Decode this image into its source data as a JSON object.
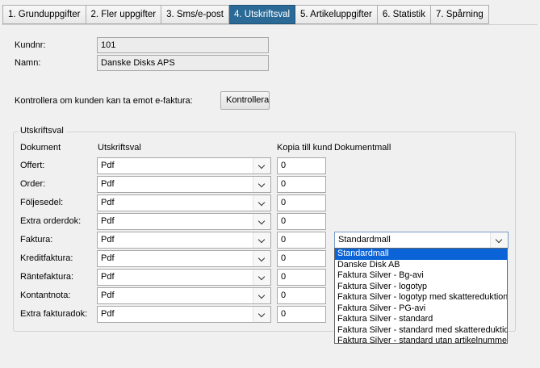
{
  "tabs": [
    {
      "label": "1. Grunduppgifter"
    },
    {
      "label": "2. Fler uppgifter"
    },
    {
      "label": "3. Sms/e-post"
    },
    {
      "label": "4. Utskriftsval"
    },
    {
      "label": "5. Artikeluppgifter"
    },
    {
      "label": "6. Statistik"
    },
    {
      "label": "7. Spårning"
    }
  ],
  "active_tab_index": 3,
  "customer": {
    "kundnr_label": "Kundnr:",
    "kundnr_value": "101",
    "namn_label": "Namn:",
    "namn_value": "Danske Disks APS"
  },
  "efaktura": {
    "label": "Kontrollera om kunden kan ta emot e-faktura:",
    "button": "Kontrollera"
  },
  "print_options": {
    "group_title": "Utskriftsval",
    "headers": {
      "dokument": "Dokument",
      "utskriftsval": "Utskriftsval",
      "kopia": "Kopia till kund",
      "mall": "Dokumentmall"
    },
    "rows": [
      {
        "label": "Offert:",
        "choice": "Pdf",
        "copies": "0"
      },
      {
        "label": "Order:",
        "choice": "Pdf",
        "copies": "0"
      },
      {
        "label": "Följesedel:",
        "choice": "Pdf",
        "copies": "0"
      },
      {
        "label": "Extra orderdok:",
        "choice": "Pdf",
        "copies": "0"
      },
      {
        "label": "Faktura:",
        "choice": "Pdf",
        "copies": "0"
      },
      {
        "label": "Kreditfaktura:",
        "choice": "Pdf",
        "copies": "0"
      },
      {
        "label": "Räntefaktura:",
        "choice": "Pdf",
        "copies": "0"
      },
      {
        "label": "Kontantnota:",
        "choice": "Pdf",
        "copies": "0"
      },
      {
        "label": "Extra fakturadok:",
        "choice": "Pdf",
        "copies": "0"
      }
    ],
    "template_selected": "Standardmall"
  },
  "template_options": [
    "Standardmall",
    "Danske Disk AB",
    "Faktura Silver - Bg-avi",
    "Faktura Silver - logotyp",
    "Faktura Silver - logotyp med skattereduktion",
    "Faktura Silver - PG-avi",
    "Faktura Silver - standard",
    "Faktura Silver - standard med skattereduktion",
    "Faktura Silver - standard utan artikelnummer"
  ],
  "colors": {
    "active_tab": "#2b6a96",
    "selected_option": "#0a64d8"
  },
  "icons": {
    "dropdown_arrow": "chevron-down-icon"
  }
}
